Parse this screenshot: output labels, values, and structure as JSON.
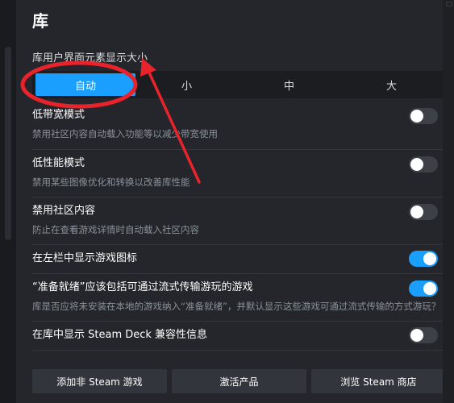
{
  "page": {
    "title": "库"
  },
  "ui_size": {
    "label": "库用户界面元素显示大小",
    "options": [
      "自动",
      "小",
      "中",
      "大"
    ],
    "selected": 0
  },
  "settings": [
    {
      "title": "低带宽模式",
      "desc": "禁用社区内容自动载入功能等以减少带宽使用",
      "on": false
    },
    {
      "title": "低性能模式",
      "desc": "禁用某些图像优化和转换以改善库性能",
      "on": false
    },
    {
      "title": "禁用社区内容",
      "desc": "防止在查看游戏详情时自动载入社区内容",
      "on": false
    },
    {
      "title": "在左栏中显示游戏图标",
      "on": true
    },
    {
      "title": "“准备就绪”应该包括可通过流式传输游玩的游戏",
      "desc": "库是否应将未安装在本地的游戏纳入“准备就绪”，并默认显示这些游戏可通过流式传输的方式游玩？",
      "on": true
    },
    {
      "title": "在库中显示 Steam Deck 兼容性信息",
      "on": false
    }
  ],
  "buttons": {
    "add_non_steam": "添加非 Steam 游戏",
    "activate": "激活产品",
    "browse_store": "浏览 Steam 商店"
  },
  "colors": {
    "accent": "#1a9fff",
    "annotation": "#e8232b"
  }
}
